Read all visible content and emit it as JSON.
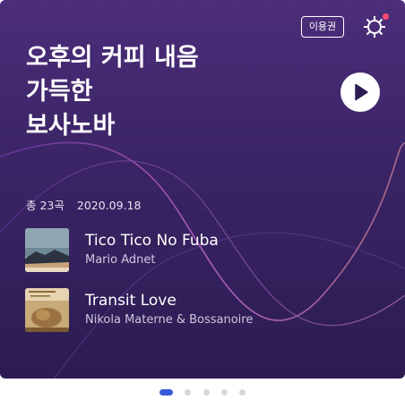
{
  "playlist": {
    "title": "오후의 커피 내음\n가득한\n보사노바",
    "count_text": "총 23곡",
    "date": "2020.09.18"
  },
  "header": {
    "ticket_label": "이용권",
    "settings_icon": "gear-icon",
    "notification_color": "#ff4d6d"
  },
  "tracks": [
    {
      "name": "Tico Tico No Fuba",
      "artist": "Mario Adnet",
      "art_icon": "album-art-seaside"
    },
    {
      "name": "Transit Love",
      "artist": "Nikola Materne & Bossanoire",
      "art_icon": "album-art-sepia"
    }
  ],
  "pager": {
    "total": 5,
    "active_index": 0,
    "active_color": "#3a5bd9"
  },
  "colors": {
    "background_top": "#4c2d7a",
    "background_bottom": "#2c1c52"
  }
}
